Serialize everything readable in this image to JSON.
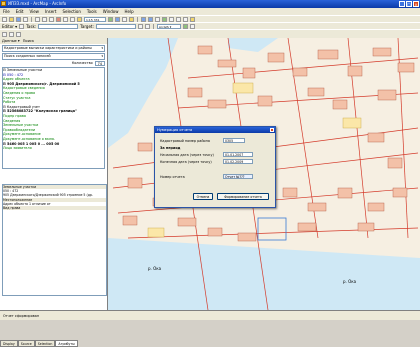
{
  "window": {
    "title": "ИПЗЗ.mxd - ArcMap - ArcInfo"
  },
  "menu": [
    "File",
    "Edit",
    "View",
    "Insert",
    "Selection",
    "Tools",
    "Window",
    "Help"
  ],
  "toolbar": {
    "scale": "1:15 331",
    "editor_label": "Editor ▾",
    "task_label": "Task:",
    "target_label": "Target:",
    "layer_combo": "ArcGIS ▾"
  },
  "left_panel": {
    "tabs": [
      "Данные ▾",
      "Поиск"
    ],
    "layer_combo": "Кадастровые выписки характеристики и районы",
    "search_combo": "Поиск созданных записей",
    "count_label": "Количество",
    "count_value": "74",
    "tree": [
      "⊟ Земельные участки",
      "  ⊟ 050 : 472",
      "      Адрес объекта",
      "    ⊟ 905 Дзержинского/г. Дзержинский 5",
      "      Кадастровые сведения",
      "      Сведения о права",
      "      Статус участка",
      "      Работа",
      "    ⊟ Кадастровый учет",
      "      ⊟ 52568083722 \"Калужская граница\"",
      "        Подпр права",
      "        Сведения",
      "        Земельные участки",
      "        Правообладатели",
      "        Документ-основание",
      "        Документ-основание о вклю.",
      "        ⊟ 5460 005 1 005 0 ... 005 00",
      "            Лицо заявителя"
    ],
    "attributes": [
      "Земельные участки",
      "050 : 472",
      "905 Дзержинского/Дзержинский 905 строение 5 (др.",
      "Местоположение",
      "Адрес объекта 1 отличие от",
      "Вид права"
    ],
    "bottom_tabs": [
      "Display",
      "Source",
      "Selection",
      "Атрибуты"
    ]
  },
  "dialog": {
    "title": "Нумерация отчета",
    "cad_label": "Кадастровый номер района",
    "cad_value": "0305",
    "period_label": "За период",
    "start_label": "Начальная дата (через точку)",
    "start_value": "01.01.2007",
    "end_label": "Конечная дата (через точку)",
    "end_value": "01.02.2009",
    "report_label": "Номер отчета",
    "report_value": "Отчет №???",
    "cancel_label": "Отмена",
    "create_label": "Формирование отчета"
  },
  "map_labels": {
    "river": "р. Ока",
    "river2": "р. Ока"
  },
  "status": {
    "text": "Отчет сформирован"
  }
}
